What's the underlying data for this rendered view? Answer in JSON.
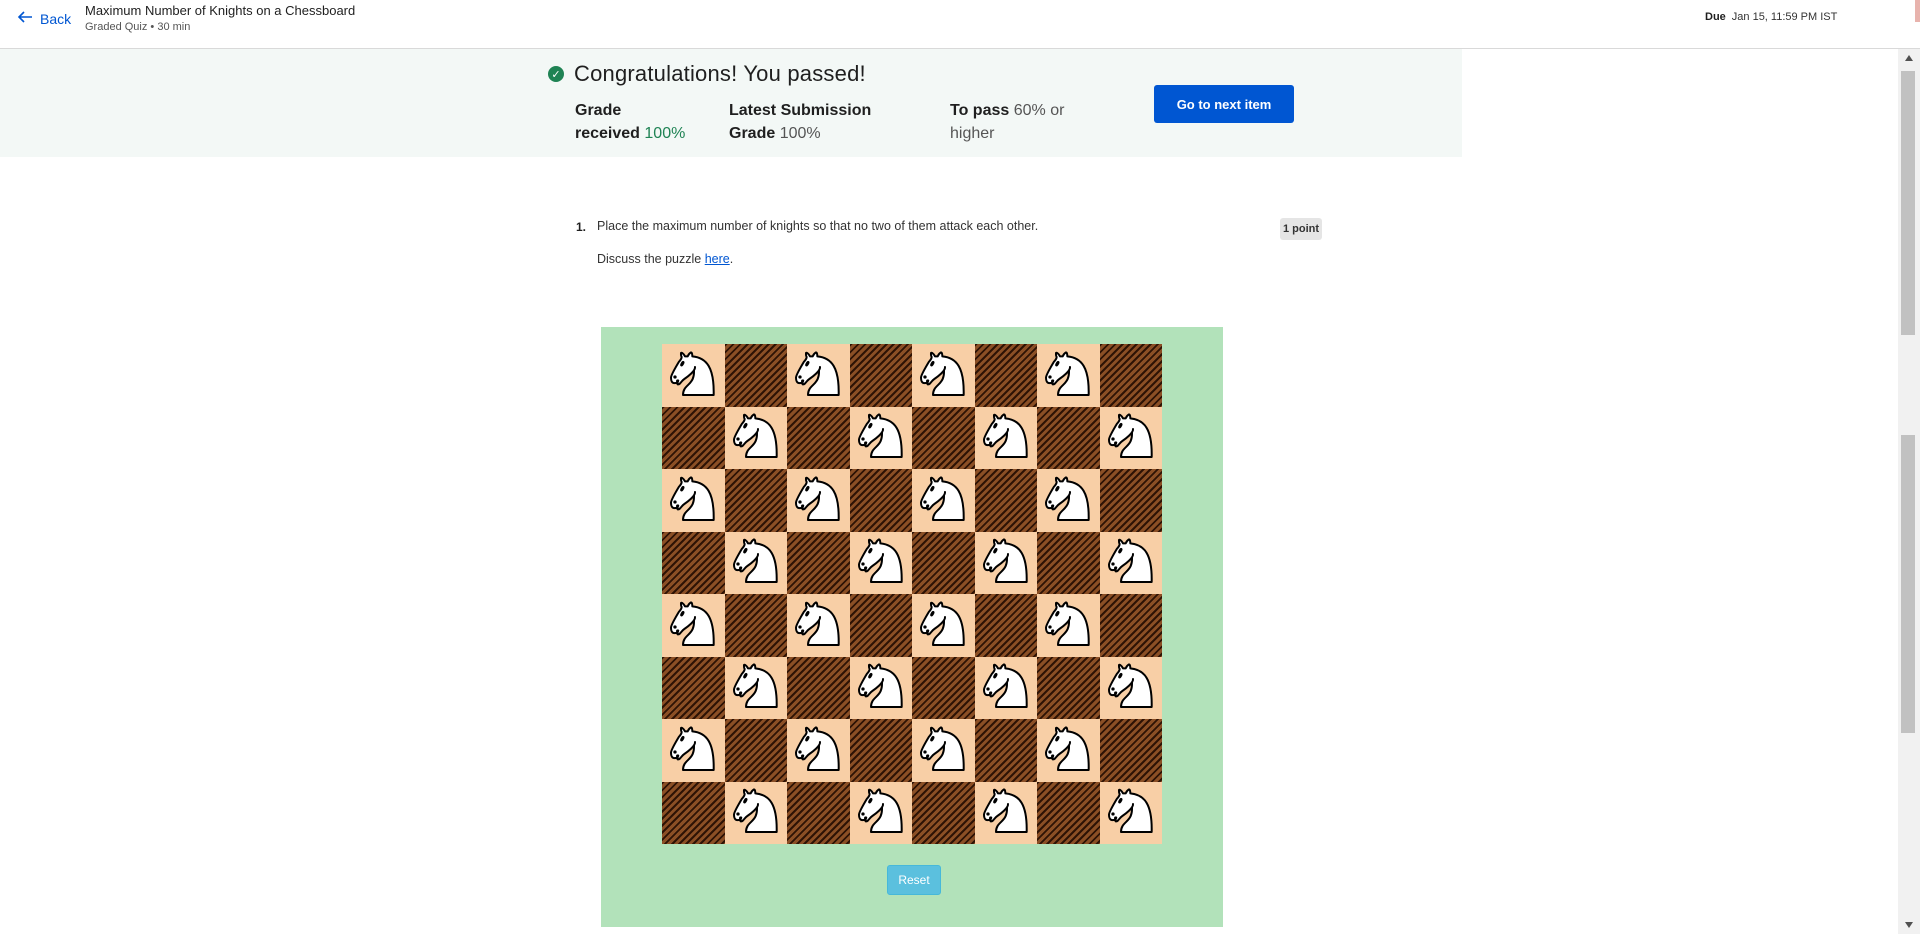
{
  "header": {
    "back_label": "Back",
    "item_title": "Maximum Number of Knights on a Chessboard",
    "item_subtitle": "Graded Quiz • 30 min",
    "due_label": "Due",
    "due_value": "Jan 15, 11:59 PM IST"
  },
  "banner": {
    "message": "Congratulations! You passed!",
    "grade_label_1": "Grade",
    "grade_label_2": "received",
    "grade_value": "100%",
    "latest_label_1": "Latest Submission",
    "latest_label_2": "Grade",
    "latest_value": "100%",
    "pass_label": "To pass",
    "pass_value": "60% or",
    "pass_value_2": "higher",
    "next_button": "Go to next item",
    "accent_color": "#1f8354",
    "button_color": "#0056d2"
  },
  "question": {
    "number": "1.",
    "text": "Place the maximum number of knights so that no two of them attack each other.",
    "discuss_prefix": "Discuss the puzzle ",
    "discuss_link": "here",
    "discuss_suffix": ".",
    "points": "1 point"
  },
  "puzzle": {
    "board_size": 8,
    "knight_icon": "white-knight-icon",
    "knights_on": "light-squares",
    "knight_count": 32,
    "reset_label": "Reset",
    "light_color": "#f8cfa6",
    "dark_color": "#5a2c10",
    "background_color": "#b2e2ba"
  }
}
